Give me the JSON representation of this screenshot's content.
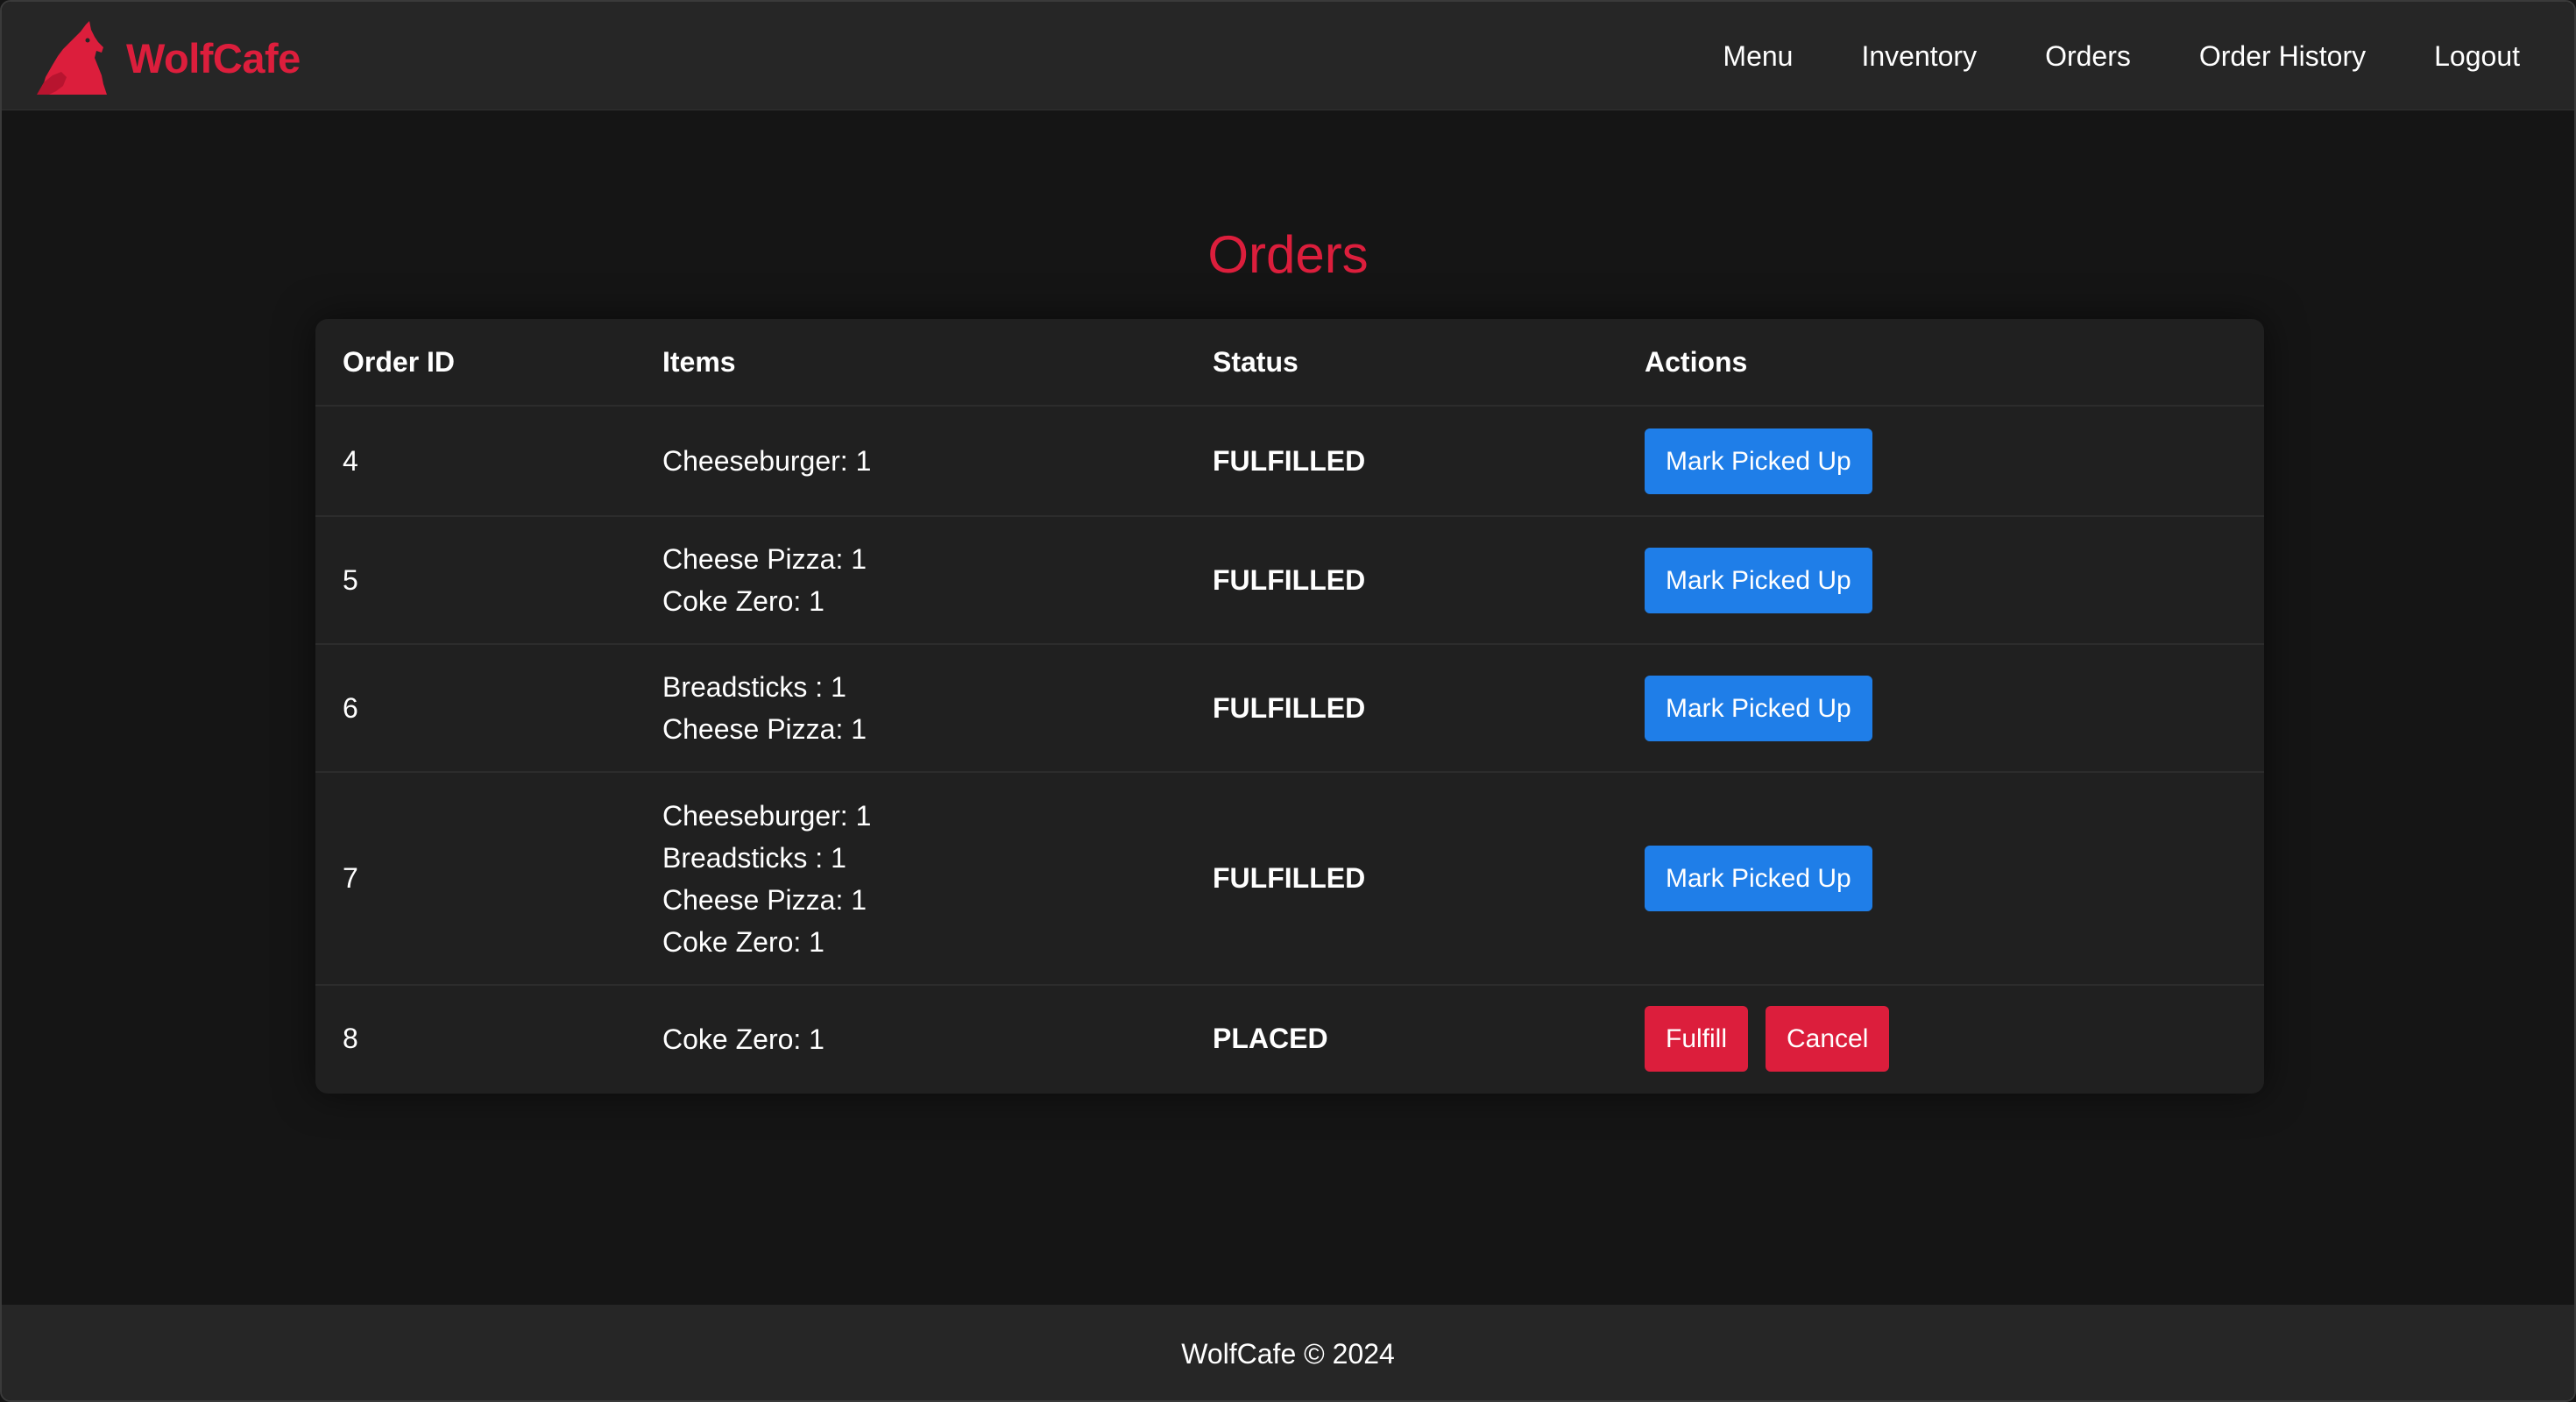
{
  "navbar": {
    "brand_name": "WolfCafe",
    "logo_icon": "wolf-howling-icon",
    "links": [
      "Menu",
      "Inventory",
      "Orders",
      "Order History",
      "Logout"
    ]
  },
  "page": {
    "title": "Orders"
  },
  "table": {
    "headers": {
      "order_id": "Order ID",
      "items": "Items",
      "status": "Status",
      "actions": "Actions"
    },
    "rows": [
      {
        "id": "4",
        "items": [
          "Cheeseburger: 1"
        ],
        "status": "FULFILLED",
        "actions": [
          "Mark Picked Up"
        ]
      },
      {
        "id": "5",
        "items": [
          "Cheese Pizza: 1",
          "Coke Zero: 1"
        ],
        "status": "FULFILLED",
        "actions": [
          "Mark Picked Up"
        ]
      },
      {
        "id": "6",
        "items": [
          "Breadsticks : 1",
          "Cheese Pizza: 1"
        ],
        "status": "FULFILLED",
        "actions": [
          "Mark Picked Up"
        ]
      },
      {
        "id": "7",
        "items": [
          "Cheeseburger: 1",
          "Breadsticks : 1",
          "Cheese Pizza: 1",
          "Coke Zero: 1"
        ],
        "status": "FULFILLED",
        "actions": [
          "Mark Picked Up"
        ]
      },
      {
        "id": "8",
        "items": [
          "Coke Zero: 1"
        ],
        "status": "PLACED",
        "actions": [
          "Fulfill",
          "Cancel"
        ]
      }
    ]
  },
  "footer": {
    "text": "WolfCafe © 2024"
  },
  "colors": {
    "brand_red": "#dc1e3c",
    "action_blue": "#1f7ee8",
    "background": "#151515",
    "bar": "#262626",
    "card": "#202020"
  }
}
